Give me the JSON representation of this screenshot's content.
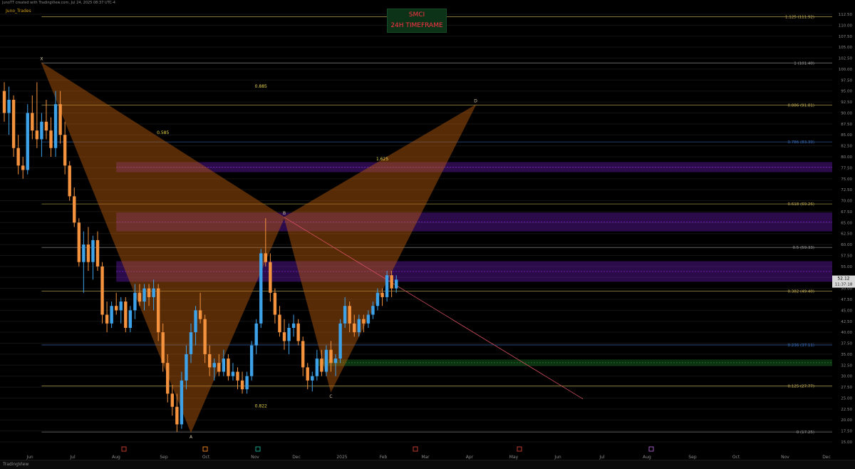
{
  "header": {
    "topline": "JunoTT created with TradingView.com, Jul 24, 2025 08:37 UTC-4",
    "author": "Juno_Trades",
    "title": "SMCI",
    "subtitle": "24H TIMEFRAME"
  },
  "footer": {
    "brand": "TradingView"
  },
  "chart_data": {
    "type": "candlestick",
    "symbol": "SMCI",
    "timeframe": "24H",
    "ylim": [
      15,
      115
    ],
    "y_ticks": [
      15,
      17.5,
      20,
      22.5,
      25,
      27.5,
      30,
      32.5,
      35,
      37.5,
      40,
      42.5,
      45,
      47.5,
      50,
      52.5,
      55,
      57.5,
      60,
      62.5,
      65,
      67.5,
      70,
      72.5,
      75,
      77.5,
      80,
      82.5,
      85,
      87.5,
      90,
      92.5,
      95,
      97.5,
      100,
      102.5,
      105,
      107.5,
      110,
      112.5
    ],
    "x_ticks": [
      "Jun",
      "Jul",
      "Aug",
      "Sep",
      "Oct",
      "Nov",
      "Dec",
      "2025",
      "Feb",
      "Mar",
      "Apr",
      "May",
      "Jun",
      "Jul",
      "Aug",
      "Sep",
      "Oct",
      "Nov",
      "Dec"
    ],
    "last_price": "52.12",
    "countdown": "11:37:18",
    "fib_levels": [
      {
        "label": "1.125 (111.92)",
        "value": 111.92,
        "color": "#c9b458"
      },
      {
        "label": "1 (101.40)",
        "value": 101.4,
        "color": "#9a9a9a"
      },
      {
        "label": "0.886 (91.81)",
        "value": 91.81,
        "color": "#c9b458"
      },
      {
        "label": "0.786 (83.39)",
        "value": 83.39,
        "color": "#3a6fbf"
      },
      {
        "label": "0.618 (69.26)",
        "value": 69.26,
        "color": "#c9b458"
      },
      {
        "label": "0.5 (59.33)",
        "value": 59.33,
        "color": "#9a9a9a"
      },
      {
        "label": "0.382 (49.40)",
        "value": 49.4,
        "color": "#c9b458"
      },
      {
        "label": "0.236 (37.11)",
        "value": 37.11,
        "color": "#3a6fbf"
      },
      {
        "label": "0.125 (27.77)",
        "value": 27.77,
        "color": "#c9b458"
      },
      {
        "label": "0 (17.25)",
        "value": 17.25,
        "color": "#9a9a9a"
      }
    ],
    "zones": [
      {
        "from": 76.5,
        "to": 78.8,
        "color": "#7a1fd0"
      },
      {
        "from": 63.0,
        "to": 67.3,
        "color": "#7a1fd0"
      },
      {
        "from": 51.5,
        "to": 56.2,
        "color": "#7a1fd0"
      },
      {
        "from": 32.3,
        "to": 33.8,
        "color": "#1f8a2e"
      }
    ],
    "pattern": {
      "points": [
        {
          "label": "X",
          "t": 8,
          "price": 101.4
        },
        {
          "label": "A",
          "t": 40,
          "price": 17.25
        },
        {
          "label": "B",
          "t": 60,
          "price": 66.2
        },
        {
          "label": "C",
          "t": 70,
          "price": 26.5
        },
        {
          "label": "D",
          "t": 101,
          "price": 91.81
        }
      ],
      "ratios": [
        {
          "label": "0.585",
          "t": 34,
          "price": 85.2
        },
        {
          "label": "0.885",
          "t": 55,
          "price": 95.8
        },
        {
          "label": "0.822",
          "t": 55,
          "price": 22.9
        },
        {
          "label": "1.625",
          "t": 81,
          "price": 79.2
        }
      ],
      "fill": "#c2600f"
    },
    "trendline": {
      "from": {
        "t": 60,
        "price": 66.2
      },
      "to": {
        "t": 124,
        "price": 24.8
      },
      "color": "#d45060"
    },
    "colors": {
      "up": "#3ea2e8",
      "down": "#f5923e"
    },
    "candles": [
      [
        95,
        97,
        88,
        90
      ],
      [
        90,
        96,
        85,
        93
      ],
      [
        93,
        94,
        80,
        82
      ],
      [
        82,
        85,
        76,
        78
      ],
      [
        78,
        80,
        75,
        77
      ],
      [
        77,
        92,
        76,
        90
      ],
      [
        90,
        94,
        84,
        86
      ],
      [
        86,
        97,
        82,
        84
      ],
      [
        84,
        90,
        80,
        88
      ],
      [
        88,
        93,
        84,
        86
      ],
      [
        86,
        89,
        80,
        82
      ],
      [
        82,
        95,
        80,
        92
      ],
      [
        92,
        95,
        83,
        85
      ],
      [
        85,
        88,
        76,
        78
      ],
      [
        78,
        79,
        70,
        71
      ],
      [
        71,
        73,
        64,
        65
      ],
      [
        65,
        66,
        55,
        56
      ],
      [
        56,
        63,
        49,
        60
      ],
      [
        60,
        64,
        54,
        56
      ],
      [
        56,
        62,
        52,
        61
      ],
      [
        61,
        63,
        54,
        55
      ],
      [
        55,
        56,
        42,
        44
      ],
      [
        44,
        47,
        40,
        42
      ],
      [
        42,
        47,
        41,
        46
      ],
      [
        46,
        49,
        44,
        45
      ],
      [
        45,
        48,
        42,
        47
      ],
      [
        47,
        48,
        40,
        41
      ],
      [
        41,
        46,
        40,
        45
      ],
      [
        45,
        51,
        43,
        49
      ],
      [
        49,
        51,
        46,
        47
      ],
      [
        47,
        51,
        45,
        50
      ],
      [
        50,
        51,
        46,
        48
      ],
      [
        48,
        52,
        45,
        50
      ],
      [
        50,
        51,
        38,
        40
      ],
      [
        40,
        42,
        31,
        33
      ],
      [
        33,
        35,
        24,
        26
      ],
      [
        26,
        28,
        21,
        23
      ],
      [
        23,
        26,
        17.3,
        19
      ],
      [
        19,
        31,
        18,
        29
      ],
      [
        29,
        37,
        27,
        35
      ],
      [
        35,
        42,
        33,
        40
      ],
      [
        40,
        46,
        37,
        45
      ],
      [
        45,
        49,
        42,
        43
      ],
      [
        43,
        44,
        33,
        35
      ],
      [
        35,
        37,
        30,
        32
      ],
      [
        32,
        34,
        29,
        33
      ],
      [
        33,
        35,
        30,
        31
      ],
      [
        31,
        36,
        30,
        34
      ],
      [
        34,
        35,
        29,
        30
      ],
      [
        30,
        33,
        29,
        31
      ],
      [
        31,
        32,
        27,
        29
      ],
      [
        29,
        31,
        26,
        27
      ],
      [
        27,
        31,
        26,
        30
      ],
      [
        30,
        38,
        29,
        37
      ],
      [
        37,
        43,
        35,
        42
      ],
      [
        42,
        59,
        41,
        58
      ],
      [
        58,
        66,
        55,
        56
      ],
      [
        56,
        58,
        47,
        49
      ],
      [
        49,
        50,
        42,
        44
      ],
      [
        44,
        46,
        39,
        40
      ],
      [
        40,
        43,
        36,
        38
      ],
      [
        38,
        42,
        35,
        41
      ],
      [
        41,
        44,
        39,
        42
      ],
      [
        42,
        43,
        37,
        38
      ],
      [
        38,
        39,
        30,
        32
      ],
      [
        32,
        33,
        27,
        29
      ],
      [
        29,
        31,
        26.5,
        30
      ],
      [
        30,
        36,
        29,
        34
      ],
      [
        34,
        36,
        30,
        31
      ],
      [
        31,
        37,
        30,
        36
      ],
      [
        36,
        38,
        31,
        33
      ],
      [
        33,
        35,
        30,
        34
      ],
      [
        34,
        43,
        33,
        42
      ],
      [
        42,
        48,
        41,
        46
      ],
      [
        46,
        47,
        40,
        42
      ],
      [
        42,
        44,
        39,
        40
      ],
      [
        40,
        44,
        39,
        43
      ],
      [
        43,
        44,
        40,
        42
      ],
      [
        42,
        45,
        41,
        44
      ],
      [
        44,
        47,
        43,
        46
      ],
      [
        46,
        50,
        45,
        49
      ],
      [
        49,
        50,
        46,
        48
      ],
      [
        48,
        54,
        47,
        53
      ],
      [
        53,
        54,
        48,
        50
      ],
      [
        50,
        53,
        49,
        52
      ]
    ]
  }
}
